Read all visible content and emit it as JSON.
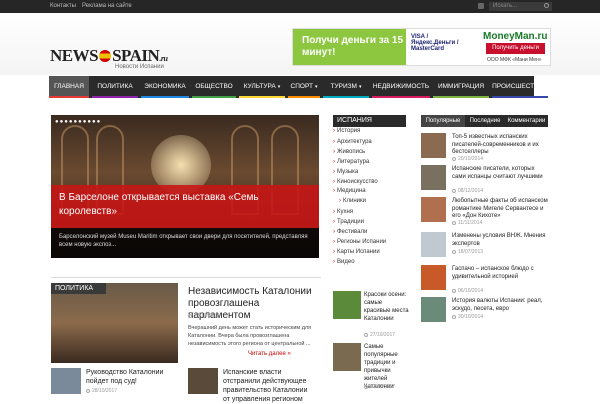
{
  "topbar": {
    "contacts": "Контакты",
    "ads": "Реклама на сайте",
    "search_placeholder": "Искать..."
  },
  "logo": {
    "text_left": "NEWS",
    "text_right": "SPAIN",
    "suffix": ".ru",
    "tagline": "Новости Испании"
  },
  "banner": {
    "headline": "Получи деньги за 15 минут!",
    "cards": "VISA / Яндекс.Деньги / MasterCard",
    "brand": "MoneyMan.ru",
    "button": "Получить деньги",
    "company": "ООО МФК «Мани Мен»"
  },
  "nav": {
    "items": [
      {
        "label": "ГЛАВНАЯ",
        "stripe": "#e53935",
        "active": true
      },
      {
        "label": "ПОЛИТИКА",
        "stripe": "#8e24aa"
      },
      {
        "label": "ЭКОНОМИКА",
        "stripe": "#1e88e5"
      },
      {
        "label": "ОБЩЕСТВО",
        "stripe": "#43a047"
      },
      {
        "label": "КУЛЬТУРА",
        "stripe": "#fdd835",
        "has_submenu": true
      },
      {
        "label": "СПОРТ",
        "stripe": "#fb8c00",
        "has_submenu": true
      },
      {
        "label": "ТУРИЗМ",
        "stripe": "#00acc1",
        "has_submenu": true
      },
      {
        "label": "НЕДВИЖИМОСТЬ",
        "stripe": "#d81b60"
      },
      {
        "label": "ИММИГРАЦИЯ",
        "stripe": "#7cb342"
      },
      {
        "label": "ПРОИСШЕСТВИЯ",
        "stripe": "#3949ab"
      }
    ]
  },
  "slider": {
    "dots": "●●●●●●●●●●",
    "title": "В Барселоне открывается выставка «Семь королевств»",
    "excerpt": "Барселонский музей Museu Maritim открывает свои двери для посетителей, представляя всем новую экспоз..."
  },
  "categories": {
    "title": "ИСПАНИЯ",
    "items": [
      "История",
      "Архитектура",
      "Живопись",
      "Литература",
      "Музыка",
      "Киноискусство",
      "Медицина",
      "Клиники",
      "Кухня",
      "Традиции",
      "Фестивали",
      "Регионы Испании",
      "Карты Испании",
      "Видео"
    ]
  },
  "tabs": {
    "items": [
      "Популярные",
      "Последние",
      "Комментарии"
    ]
  },
  "popular": [
    {
      "title": "Топ-5 известных испанских писателей-современников и их бестселлеры",
      "date": "20/10/2014"
    },
    {
      "title": "Испанские писатели, которых сами испанцы считают лучшими",
      "date": "08/12/2014"
    },
    {
      "title": "Любопытные факты об испанском романтике Мигеле Сервантесе и его «Дон Кихоте»",
      "date": "11/11/2014"
    },
    {
      "title": "Изменены условия ВНЖ. Мнения экспертов",
      "date": "18/07/2013"
    },
    {
      "title": "Гаспачо – испанское блюдо с удивительной историей",
      "date": "06/10/2014"
    },
    {
      "title": "История валюты Испании: реал, эскудо, песета, евро",
      "date": "30/10/2014"
    }
  ],
  "politics": {
    "label": "ПОЛИТИКА",
    "title": "Независимость Каталонии провозглашена парламентом",
    "date": "28/10/2017",
    "text": "Вчерашний день может стать историческим для Каталонии. Вчера была провозглашена независимость этого региона от центральной ...",
    "readmore": "Читать далее »"
  },
  "bottom": [
    {
      "title": "Руководство Каталонии пойдет под суд!",
      "date": "28/10/2017"
    },
    {
      "title": "Испанские власти отстранили действующее правительство Каталонии от управления регионом",
      "date": ""
    }
  ],
  "middle": [
    {
      "title": "Красоки осени: самые красивые места Каталонии",
      "date": "27/10/2017"
    },
    {
      "title": "Самые популярные традиции и привычки жителей Каталонии",
      "date": "12/10/2017"
    }
  ]
}
